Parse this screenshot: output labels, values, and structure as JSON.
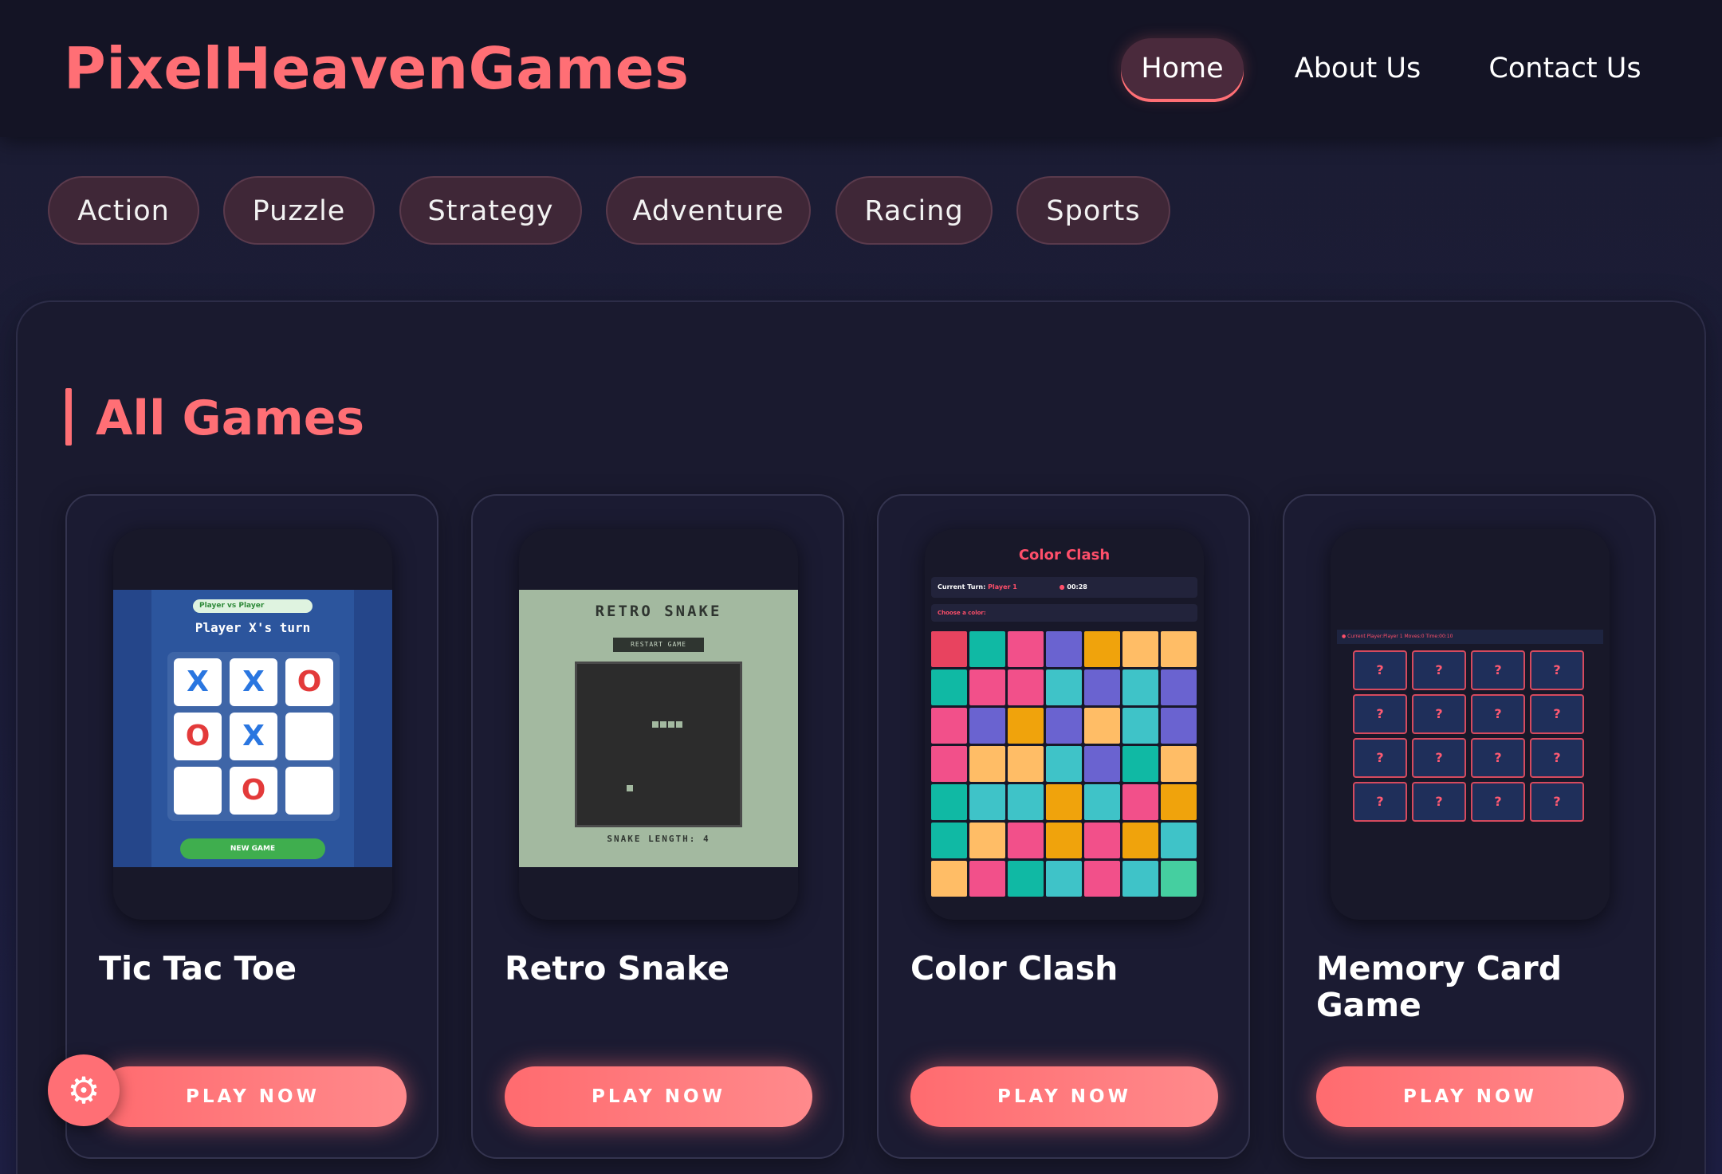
{
  "header": {
    "logo": "PixelHeavenGames",
    "nav": [
      {
        "label": "Home",
        "active": true
      },
      {
        "label": "About Us"
      },
      {
        "label": "Contact Us"
      }
    ]
  },
  "categories": [
    "Action",
    "Puzzle",
    "Strategy",
    "Adventure",
    "Racing",
    "Sports"
  ],
  "section": {
    "title": "All Games"
  },
  "games": [
    {
      "title": "Tic Tac Toe",
      "play_label": "PLAY NOW",
      "thumb": {
        "mode": "Player vs Player",
        "turn": "Player X's turn",
        "board": [
          "X",
          "X",
          "O",
          "O",
          "X",
          "",
          "",
          "O",
          ""
        ],
        "new_game": "NEW GAME"
      }
    },
    {
      "title": "Retro Snake",
      "play_label": "PLAY NOW",
      "thumb": {
        "title": "RETRO SNAKE",
        "restart": "RESTART GAME",
        "length_text": "SNAKE LENGTH: 4"
      }
    },
    {
      "title": "Color Clash",
      "play_label": "PLAY NOW",
      "thumb": {
        "title": "Color Clash",
        "turn_label": "Current Turn:",
        "turn_player": "Player 1",
        "timer": "00:28",
        "choose": "Choose a color:"
      }
    },
    {
      "title": "Memory Card Game",
      "play_label": "PLAY NOW",
      "thumb": {
        "status": "● Current Player:Player 1    Moves:0    Time:00:10",
        "card_symbol": "?"
      }
    }
  ],
  "colors": {
    "accent": "#ff6f75",
    "background": "#1b1c32",
    "card": "#1b1b32"
  },
  "fab": {
    "icon": "gear-icon"
  }
}
